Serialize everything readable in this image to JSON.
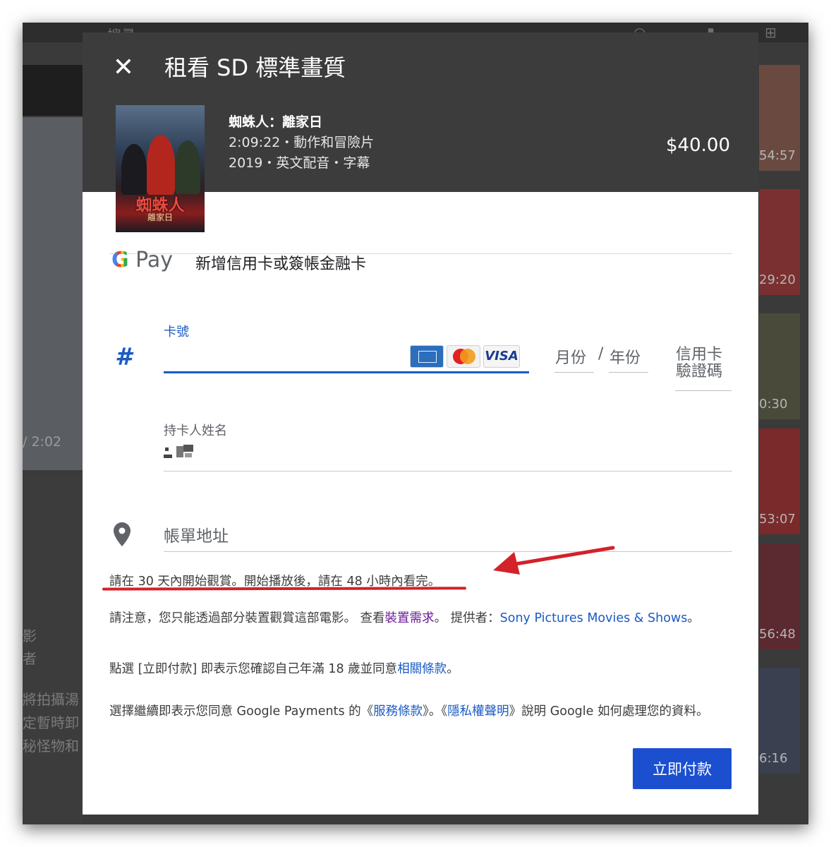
{
  "dialog": {
    "title": "租看 SD 標準畫質",
    "close_icon": "close-icon"
  },
  "movie": {
    "title": "蜘蛛人：離家日",
    "meta_line1": "2:09:22・動作和冒險片",
    "meta_line2": "2019・英文配音・字幕",
    "price": "$40.00",
    "poster": {
      "title": "蜘蛛人",
      "subtitle": "離家日"
    }
  },
  "payment": {
    "gpay_g": "G",
    "gpay_pay": "Pay",
    "add_card_label": "新增信用卡或簽帳金融卡",
    "card_number_label": "卡號",
    "card_number_icon": "#",
    "card_brands": [
      "amex-logo",
      "mastercard-logo",
      "visa-logo"
    ],
    "visa_text": "VISA",
    "expiry_month_label": "月份",
    "expiry_separator": "/",
    "expiry_year_label": "年份",
    "cvc_label": "信用卡驗證碼",
    "cardholder_label": "持卡人姓名",
    "billing_address_label": "帳單地址",
    "billing_icon": "location-pin-icon"
  },
  "notes": {
    "watch_window": "請在 30 天內開始觀賞。開始播放後，請在 48 小時內看完。",
    "device_notice_prefix": "請注意，您只能透過部分裝置觀賞這部電影。 查看",
    "device_requirements_link": "裝置需求",
    "device_notice_mid": "。 提供者：",
    "provider_link": "Sony Pictures Movies & Shows",
    "device_notice_suffix": "。",
    "age_notice_prefix": "點選 [立即付款] 即表示您確認自己年滿 18 歲並同意",
    "related_terms_link": "相關條款",
    "age_notice_suffix": "。",
    "gp_prefix": "選擇繼續即表示您同意 Google Payments 的《",
    "terms_link": "服務條款",
    "gp_mid": "》。《",
    "privacy_link": "隱私權聲明",
    "gp_suffix": "》說明 Google 如何處理您的資料。"
  },
  "actions": {
    "pay_now": "立即付款"
  },
  "background": {
    "search_placeholder": "搜尋",
    "video_time": "/ 2:02",
    "side_text": [
      "影",
      "者",
      "將拍攝湯",
      "定暫時卸",
      "秘怪物和"
    ],
    "thumb_times": [
      "54:57",
      "29:20",
      "0:30",
      "53:07",
      "56:48",
      "6:16"
    ]
  },
  "colors": {
    "accent": "#1c4fd0",
    "link_blue": "#1a5bc4",
    "link_visited": "#6a1b9a",
    "annotation_red": "#d3222a",
    "header_bg": "#3c3c3c"
  }
}
